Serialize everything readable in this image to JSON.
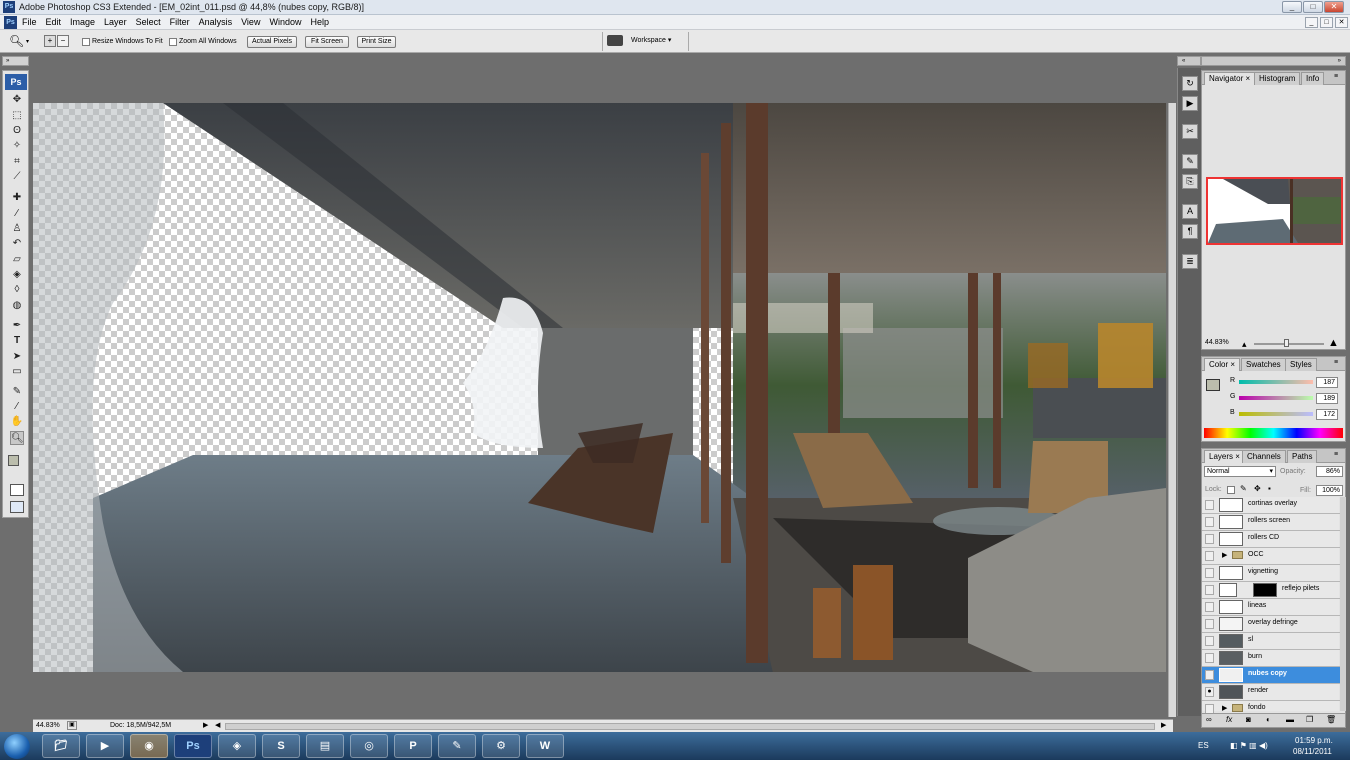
{
  "window": {
    "title": "Adobe Photoshop CS3 Extended - [EM_02int_011.psd @ 44,8% (nubes copy, RGB/8)]",
    "app_icon": "Ps",
    "controls": [
      "_",
      "□",
      "✕"
    ]
  },
  "menu": {
    "items": [
      "File",
      "Edit",
      "Image",
      "Layer",
      "Select",
      "Filter",
      "Analysis",
      "View",
      "Window",
      "Help"
    ]
  },
  "options": {
    "resize_windows": "Resize Windows To Fit",
    "zoom_all": "Zoom All Windows",
    "actual_pixels": "Actual Pixels",
    "fit_screen": "Fit Screen",
    "print_size": "Print Size",
    "workspace": "Workspace ▾"
  },
  "toolbox": {
    "logo": "Ps",
    "tools": [
      "move",
      "marquee",
      "lasso",
      "magic-wand",
      "crop",
      "slice",
      "healing",
      "brush",
      "stamp",
      "history-brush",
      "eraser",
      "bucket",
      "blur",
      "dodge",
      "pen",
      "type",
      "path-select",
      "shape",
      "notes",
      "eyedropper",
      "hand",
      "zoom"
    ]
  },
  "status": {
    "zoom": "44.83%",
    "doc": "Doc: 18,5M/942,5M"
  },
  "navigator": {
    "tabs": [
      "Navigator",
      "Histogram",
      "Info"
    ],
    "zoom": "44.83%"
  },
  "color": {
    "tabs": [
      "Color",
      "Swatches",
      "Styles"
    ],
    "r_label": "R",
    "g_label": "G",
    "b_label": "B",
    "r": "187",
    "g": "189",
    "b": "172",
    "swatch_color": "#bbbdac"
  },
  "layers": {
    "tabs": [
      "Layers",
      "Channels",
      "Paths"
    ],
    "blend_mode": "Normal",
    "opacity_label": "Opacity:",
    "opacity": "86%",
    "lock_label": "Lock:",
    "fill_label": "Fill:",
    "fill": "100%",
    "items": [
      {
        "name": "cortinas overlay"
      },
      {
        "name": "rollers screen"
      },
      {
        "name": "rollers CD"
      },
      {
        "name": "OCC"
      },
      {
        "name": "vignetting"
      },
      {
        "name": "reflejo pilets"
      },
      {
        "name": "lineas"
      },
      {
        "name": "overlay defringe"
      },
      {
        "name": "sl"
      },
      {
        "name": "burn"
      },
      {
        "name": "nubes copy"
      },
      {
        "name": "render"
      },
      {
        "name": "fondo"
      }
    ]
  },
  "taskbar": {
    "apps": [
      "explorer",
      "media-player",
      "firefox",
      "photoshop",
      "sketchup",
      "skype",
      "winrar",
      "cinema4d",
      "pix",
      "notes",
      "network",
      "word"
    ],
    "ps_label": "Ps",
    "lang": "ES",
    "time": "01:59 p.m.",
    "date": "08/11/2011"
  }
}
